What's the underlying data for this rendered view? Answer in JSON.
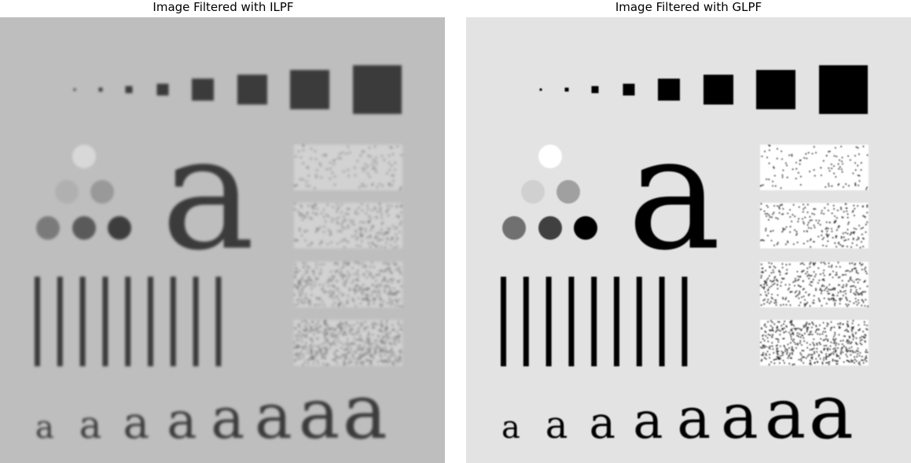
{
  "panels": [
    {
      "title": "Image Filtered with ILPF",
      "background": "#bebebe",
      "dark": "#3a3a3a",
      "circles": [
        "#d8d8d8",
        "#b0b0b0",
        "#999999",
        "#7a7a7a",
        "#5a5a5a",
        "#3c3c3c"
      ],
      "blur": 1.6
    },
    {
      "title": "Image Filtered with GLPF",
      "background": "#e3e3e3",
      "dark": "#000000",
      "circles": [
        "#ffffff",
        "#d0d0d0",
        "#a0a0a0",
        "#707070",
        "#404040",
        "#000000"
      ],
      "blur": 0.8
    }
  ],
  "letter": "a"
}
